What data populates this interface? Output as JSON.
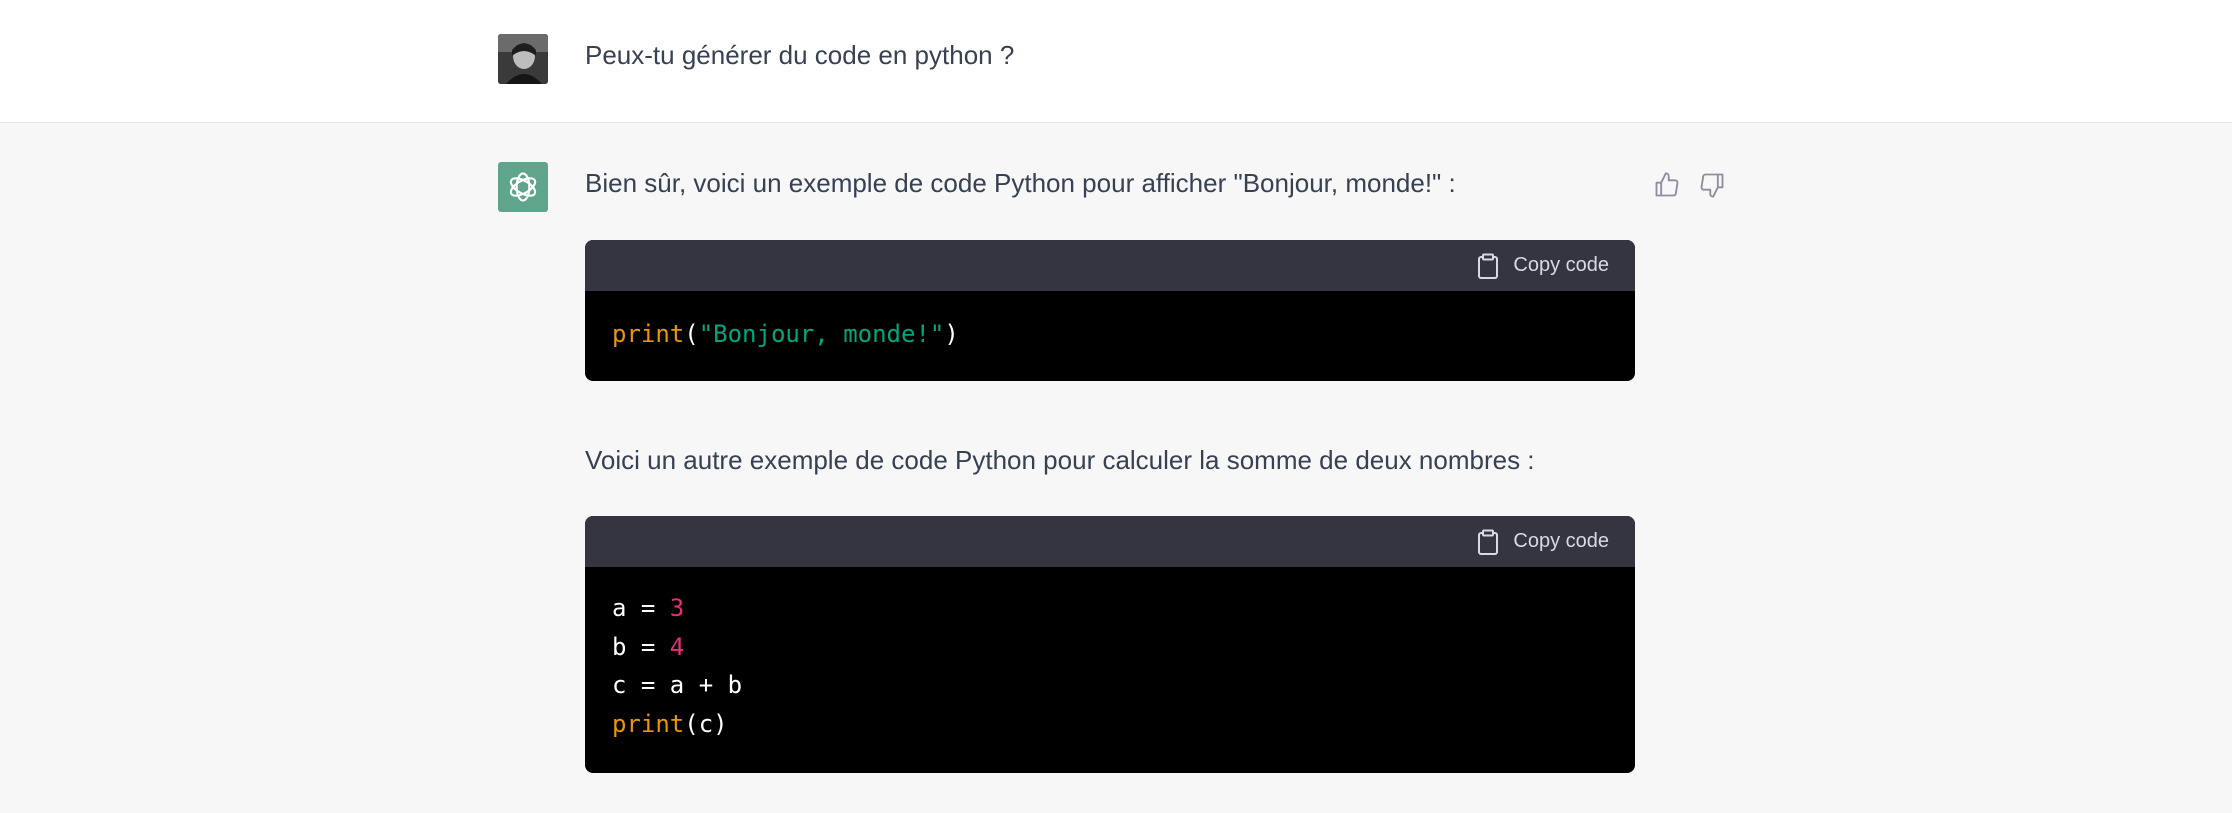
{
  "user_message": {
    "avatar": "user-avatar-photo",
    "text": "Peux-tu générer du code en python ?"
  },
  "assistant_message": {
    "avatar": "openai-logo-icon",
    "intro_text": "Bien sûr, voici un exemple de code Python pour afficher \"Bonjour, monde!\" :",
    "second_text": "Voici un autre exemple de code Python pour calculer la somme de deux nombres :",
    "feedback": {
      "thumbs_up_icon": "thumbs-up-icon",
      "thumbs_down_icon": "thumbs-down-icon"
    },
    "code_blocks": [
      {
        "copy_label": "Copy code",
        "lines": [
          [
            {
              "t": "print",
              "k": "fn"
            },
            {
              "t": "(",
              "k": "plain"
            },
            {
              "t": "\"Bonjour, monde!\"",
              "k": "str"
            },
            {
              "t": ")",
              "k": "plain"
            }
          ]
        ]
      },
      {
        "copy_label": "Copy code",
        "lines": [
          [
            {
              "t": "a = ",
              "k": "plain"
            },
            {
              "t": "3",
              "k": "num"
            }
          ],
          [
            {
              "t": "b = ",
              "k": "plain"
            },
            {
              "t": "4",
              "k": "num"
            }
          ],
          [
            {
              "t": "c = a + b",
              "k": "plain"
            }
          ],
          [
            {
              "t": "print",
              "k": "fn"
            },
            {
              "t": "(c)",
              "k": "plain"
            }
          ]
        ]
      }
    ]
  },
  "colors": {
    "bot_avatar_bg": "#5fa58c",
    "code_header_bg": "#343541",
    "code_body_bg": "#000000",
    "fn": "#e9950c",
    "string": "#00a67d",
    "number": "#df3079"
  }
}
